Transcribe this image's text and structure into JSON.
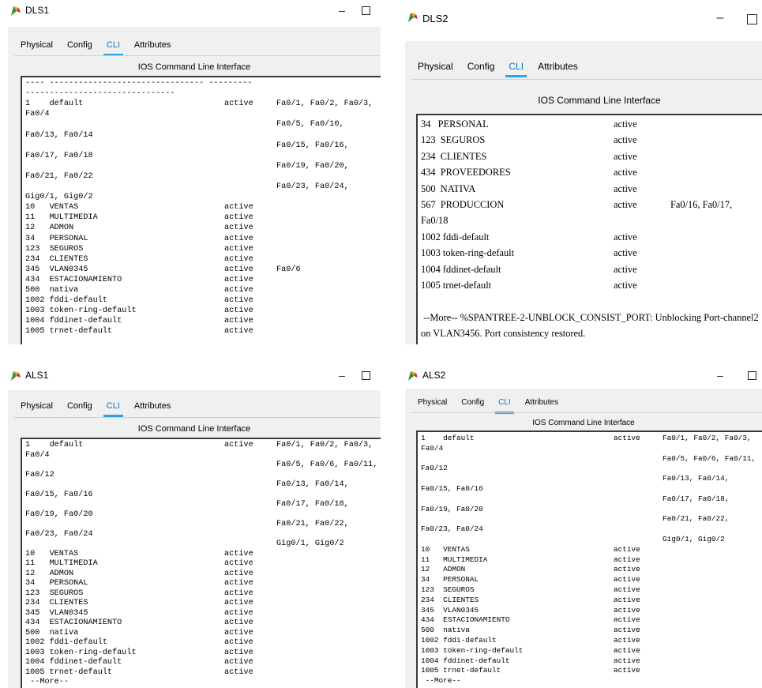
{
  "tabs": [
    "Physical",
    "Config",
    "CLI",
    "Attributes"
  ],
  "active_tab": "CLI",
  "ios_title": "IOS Command Line Interface",
  "controls": {
    "minimize": "–"
  },
  "windows": {
    "dls1": {
      "title": "DLS1",
      "rows": [
        [
          "---- -------------------------------- ---------",
          "",
          ""
        ],
        [
          "-------------------------------",
          "",
          ""
        ],
        [
          "1    default",
          "active",
          "Fa0/1, Fa0/2, Fa0/3,"
        ],
        [
          "Fa0/4",
          "",
          ""
        ],
        [
          "",
          "",
          "Fa0/5, Fa0/10,"
        ],
        [
          "Fa0/13, Fa0/14",
          "",
          ""
        ],
        [
          "",
          "",
          "Fa0/15, Fa0/16,"
        ],
        [
          "Fa0/17, Fa0/18",
          "",
          ""
        ],
        [
          "",
          "",
          "Fa0/19, Fa0/20,"
        ],
        [
          "Fa0/21, Fa0/22",
          "",
          ""
        ],
        [
          "",
          "",
          "Fa0/23, Fa0/24,"
        ],
        [
          "Gig0/1, Gig0/2",
          "",
          ""
        ],
        [
          "10   VENTAS",
          "active",
          ""
        ],
        [
          "11   MULTIMEDIA",
          "active",
          ""
        ],
        [
          "12   ADMON",
          "active",
          ""
        ],
        [
          "34   PERSONAL",
          "active",
          ""
        ],
        [
          "123  SEGUROS",
          "active",
          ""
        ],
        [
          "234  CLIENTES",
          "active",
          ""
        ],
        [
          "345  VLAN0345",
          "active",
          "Fa0/6"
        ],
        [
          "434  ESTACIONAMIENTO",
          "active",
          ""
        ],
        [
          "500  nativa",
          "active",
          ""
        ],
        [
          "1002 fddi-default",
          "active",
          ""
        ],
        [
          "1003 token-ring-default",
          "active",
          ""
        ],
        [
          "1004 fddinet-default",
          "active",
          ""
        ],
        [
          "1005 trnet-default",
          "active",
          ""
        ]
      ]
    },
    "dls2": {
      "title": "DLS2",
      "rows": [
        [
          "34   PERSONAL",
          "active",
          ""
        ],
        [
          "123  SEGUROS",
          "active",
          ""
        ],
        [
          "234  CLIENTES",
          "active",
          ""
        ],
        [
          "434  PROVEEDORES",
          "active",
          ""
        ],
        [
          "500  NATIVA",
          "active",
          ""
        ],
        [
          "567  PRODUCCION",
          "active",
          "Fa0/16, Fa0/17,"
        ],
        [
          "Fa0/18",
          "",
          ""
        ],
        [
          "1002 fddi-default",
          "active",
          ""
        ],
        [
          "1003 token-ring-default",
          "active",
          ""
        ],
        [
          "1004 fddinet-default",
          "active",
          ""
        ],
        [
          "1005 trnet-default",
          "active",
          ""
        ],
        [
          "",
          "",
          ""
        ],
        [
          " --More-- %SPANTREE-2-UNBLOCK_CONSIST_PORT: Unblocking Port-channel2",
          "",
          ""
        ],
        [
          "on VLAN3456. Port consistency restored.",
          "",
          ""
        ]
      ]
    },
    "als1": {
      "title": "ALS1",
      "rows": [
        [
          "1    default",
          "active",
          "Fa0/1, Fa0/2, Fa0/3,"
        ],
        [
          "Fa0/4",
          "",
          ""
        ],
        [
          "",
          "",
          "Fa0/5, Fa0/6, Fa0/11,"
        ],
        [
          "Fa0/12",
          "",
          ""
        ],
        [
          "",
          "",
          "Fa0/13, Fa0/14,"
        ],
        [
          "Fa0/15, Fa0/16",
          "",
          ""
        ],
        [
          "",
          "",
          "Fa0/17, Fa0/18,"
        ],
        [
          "Fa0/19, Fa0/20",
          "",
          ""
        ],
        [
          "",
          "",
          "Fa0/21, Fa0/22,"
        ],
        [
          "Fa0/23, Fa0/24",
          "",
          ""
        ],
        [
          "",
          "",
          "Gig0/1, Gig0/2"
        ],
        [
          "10   VENTAS",
          "active",
          ""
        ],
        [
          "11   MULTIMEDIA",
          "active",
          ""
        ],
        [
          "12   ADMON",
          "active",
          ""
        ],
        [
          "34   PERSONAL",
          "active",
          ""
        ],
        [
          "123  SEGUROS",
          "active",
          ""
        ],
        [
          "234  CLIENTES",
          "active",
          ""
        ],
        [
          "345  VLAN0345",
          "active",
          ""
        ],
        [
          "434  ESTACIONAMIENTO",
          "active",
          ""
        ],
        [
          "500  nativa",
          "active",
          ""
        ],
        [
          "1002 fddi-default",
          "active",
          ""
        ],
        [
          "1003 token-ring-default",
          "active",
          ""
        ],
        [
          "1004 fddinet-default",
          "active",
          ""
        ],
        [
          "1005 trnet-default",
          "active",
          ""
        ],
        [
          " --More--",
          "",
          ""
        ]
      ]
    },
    "als2": {
      "title": "ALS2",
      "rows": [
        [
          "1    default",
          "active",
          "Fa0/1, Fa0/2, Fa0/3,"
        ],
        [
          "Fa0/4",
          "",
          ""
        ],
        [
          "",
          "",
          "Fa0/5, Fa0/6, Fa0/11,"
        ],
        [
          "Fa0/12",
          "",
          ""
        ],
        [
          "",
          "",
          "Fa0/13, Fa0/14,"
        ],
        [
          "Fa0/15, Fa0/16",
          "",
          ""
        ],
        [
          "",
          "",
          "Fa0/17, Fa0/18,"
        ],
        [
          "Fa0/19, Fa0/20",
          "",
          ""
        ],
        [
          "",
          "",
          "Fa0/21, Fa0/22,"
        ],
        [
          "Fa0/23, Fa0/24",
          "",
          ""
        ],
        [
          "",
          "",
          "Gig0/1, Gig0/2"
        ],
        [
          "10   VENTAS",
          "active",
          ""
        ],
        [
          "11   MULTIMEDIA",
          "active",
          ""
        ],
        [
          "12   ADMON",
          "active",
          ""
        ],
        [
          "34   PERSONAL",
          "active",
          ""
        ],
        [
          "123  SEGUROS",
          "active",
          ""
        ],
        [
          "234  CLIENTES",
          "active",
          ""
        ],
        [
          "345  VLAN0345",
          "active",
          ""
        ],
        [
          "434  ESTACIONAMIENTO",
          "active",
          ""
        ],
        [
          "500  nativa",
          "active",
          ""
        ],
        [
          "1002 fddi-default",
          "active",
          ""
        ],
        [
          "1003 token-ring-default",
          "active",
          ""
        ],
        [
          "1004 fddinet-default",
          "active",
          ""
        ],
        [
          "1005 trnet-default",
          "active",
          ""
        ],
        [
          " --More--",
          "",
          ""
        ]
      ]
    }
  }
}
